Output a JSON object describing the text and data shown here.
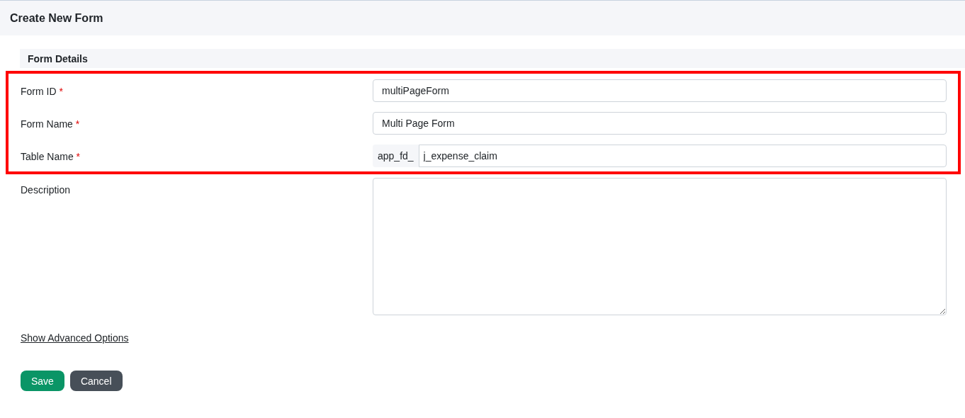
{
  "header": {
    "title": "Create New Form"
  },
  "section": {
    "title": "Form Details"
  },
  "fields": [
    {
      "label": "Form ID",
      "required_mark": "*",
      "kind": "text",
      "value": "multiPageForm",
      "highlighted": true
    },
    {
      "label": "Form Name",
      "required_mark": "*",
      "kind": "text",
      "value": "Multi Page Form",
      "highlighted": true
    },
    {
      "label": "Table Name",
      "required_mark": "*",
      "kind": "prefixed",
      "prefix": "app_fd_",
      "value": "j_expense_claim",
      "highlighted": true
    },
    {
      "label": "Description",
      "kind": "textarea",
      "highlighted": false
    }
  ],
  "advanced_link": "Show Advanced Options",
  "buttons": [
    {
      "label": "Save",
      "kind": "primary"
    },
    {
      "label": "Cancel",
      "kind": "secondary"
    }
  ]
}
